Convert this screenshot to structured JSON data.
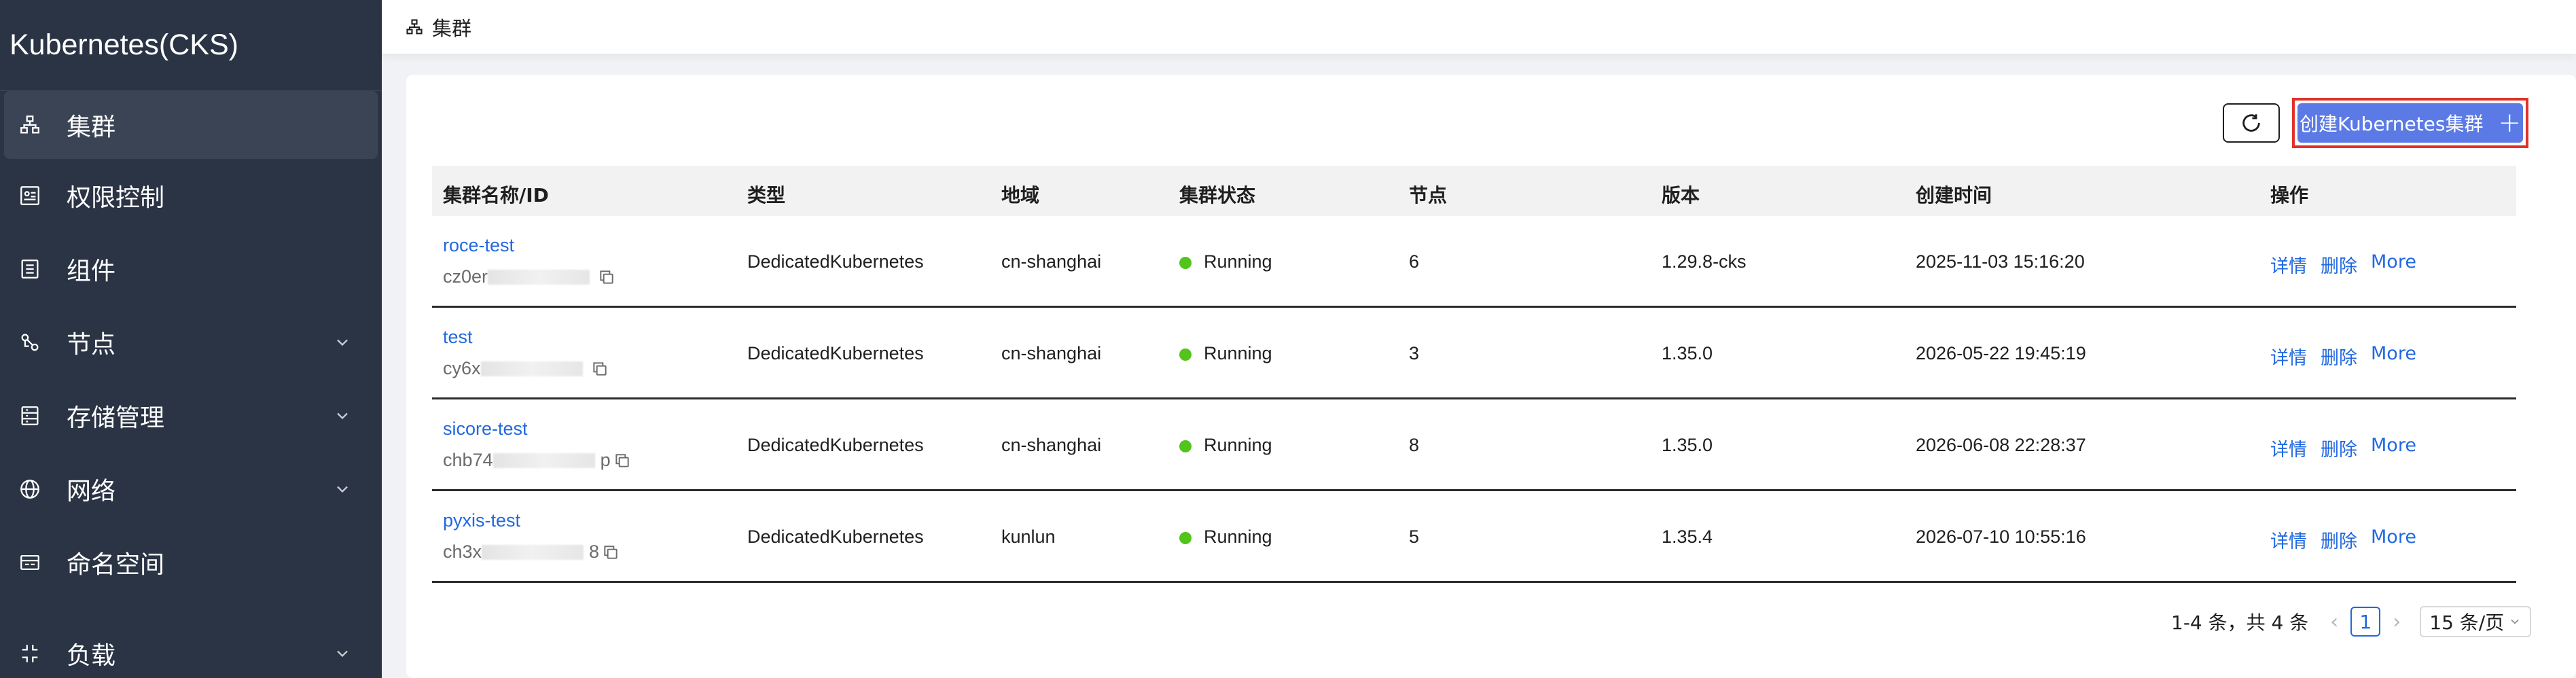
{
  "app": {
    "title": "Kubernetes(CKS)"
  },
  "sidebar": {
    "items": [
      {
        "label": "集群",
        "icon": "cluster-icon",
        "active": true,
        "expandable": false
      },
      {
        "label": "权限控制",
        "icon": "permission-icon",
        "active": false,
        "expandable": false
      },
      {
        "label": "组件",
        "icon": "component-icon",
        "active": false,
        "expandable": false
      },
      {
        "label": "节点",
        "icon": "node-icon",
        "active": false,
        "expandable": true
      },
      {
        "label": "存储管理",
        "icon": "storage-icon",
        "active": false,
        "expandable": true
      },
      {
        "label": "网络",
        "icon": "globe-icon",
        "active": false,
        "expandable": true
      },
      {
        "label": "命名空间",
        "icon": "namespace-icon",
        "active": false,
        "expandable": false
      },
      {
        "label": "负载",
        "icon": "workload-icon",
        "active": false,
        "expandable": true
      }
    ]
  },
  "header": {
    "breadcrumb": "集群"
  },
  "toolbar": {
    "create_label": "创建Kubernetes集群",
    "create_plus": "+"
  },
  "table": {
    "columns": [
      "集群名称/ID",
      "类型",
      "地域",
      "集群状态",
      "节点",
      "版本",
      "创建时间",
      "操作"
    ],
    "rows": [
      {
        "name": "roce-test",
        "id_prefix": "cz0er",
        "id_suffix": "",
        "type": "DedicatedKubernetes",
        "region": "cn-shanghai",
        "status": "Running",
        "nodes": "6",
        "version": "1.29.8-cks",
        "created": "2025-11-03 15:16:20"
      },
      {
        "name": "test",
        "id_prefix": "cy6x",
        "id_suffix": "",
        "type": "DedicatedKubernetes",
        "region": "cn-shanghai",
        "status": "Running",
        "nodes": "3",
        "version": "1.35.0",
        "created": "2026-05-22 19:45:19"
      },
      {
        "name": "sicore-test",
        "id_prefix": "chb74",
        "id_suffix": "p",
        "type": "DedicatedKubernetes",
        "region": "cn-shanghai",
        "status": "Running",
        "nodes": "8",
        "version": "1.35.0",
        "created": "2026-06-08 22:28:37"
      },
      {
        "name": "pyxis-test",
        "id_prefix": "ch3x",
        "id_suffix": "8",
        "type": "DedicatedKubernetes",
        "region": "kunlun",
        "status": "Running",
        "nodes": "5",
        "version": "1.35.4",
        "created": "2026-07-10 10:55:16"
      }
    ],
    "ops": {
      "detail": "详情",
      "delete": "删除",
      "more": "More"
    }
  },
  "pagination": {
    "total_text": "1-4 条，共 4 条",
    "prev": "‹",
    "current": "1",
    "next": "›",
    "page_size": "15 条/页"
  },
  "colors": {
    "sidebar_bg": "#2a3444",
    "primary": "#5b7ae6",
    "link": "#2168e0",
    "status_ok": "#52c41a",
    "highlight_border": "#e0322a"
  }
}
